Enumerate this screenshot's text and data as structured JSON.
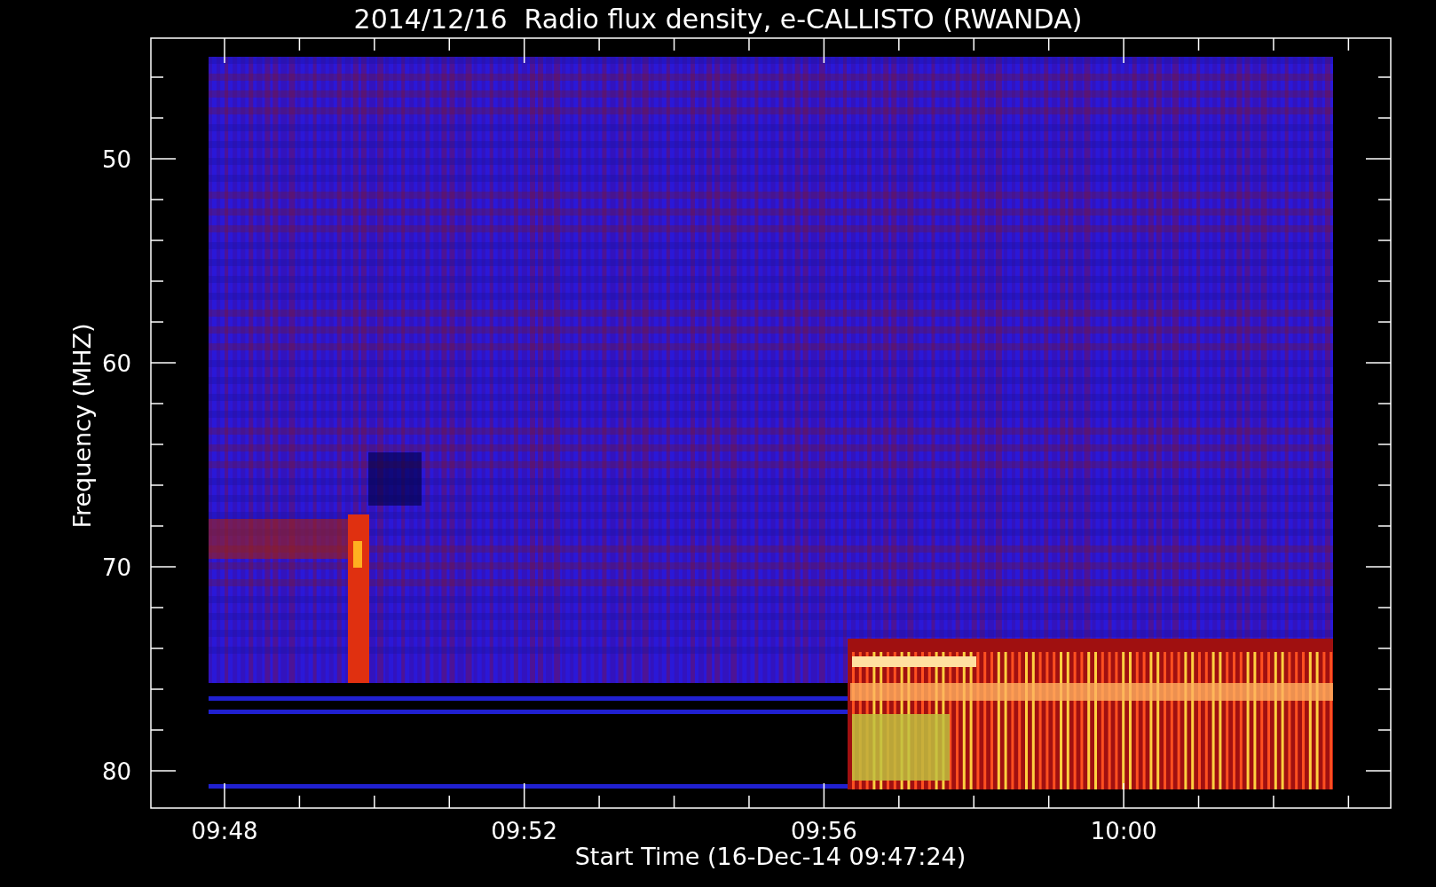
{
  "title": "2014/12/16  Radio flux density, e-CALLISTO (RWANDA)",
  "y_axis": {
    "label": "Frequency (MHZ)",
    "ticks": [
      "50",
      "60",
      "70",
      "80"
    ]
  },
  "x_axis": {
    "label": "Start Time (16-Dec-14 09:47:24)",
    "ticks": [
      "09:48",
      "09:52",
      "09:56",
      "10:00"
    ]
  }
}
